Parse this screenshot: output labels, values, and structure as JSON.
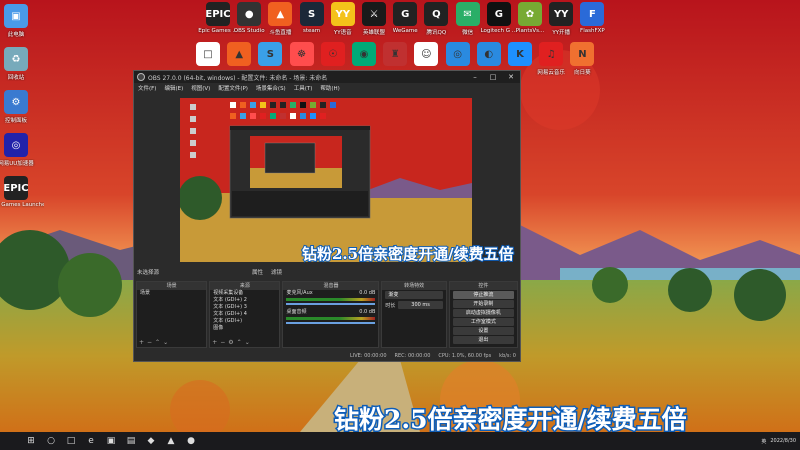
{
  "desktop": {
    "top_icons": [
      {
        "label": "Epic Games ...",
        "glyph": "EPIC",
        "color": "#222222"
      },
      {
        "label": "OBS Studio",
        "glyph": "●",
        "color": "#333333"
      },
      {
        "label": "斗鱼直播",
        "glyph": "▲",
        "color": "#f06020"
      },
      {
        "label": "steam",
        "glyph": "S",
        "color": "#1b2838"
      },
      {
        "label": "YY语音",
        "glyph": "YY",
        "color": "#f4c21a"
      },
      {
        "label": "英雄联盟",
        "glyph": "⚔",
        "color": "#1a1a1a"
      },
      {
        "label": "WeGame",
        "glyph": "G",
        "color": "#222222"
      },
      {
        "label": "腾讯QQ",
        "glyph": "Q",
        "color": "#222222"
      },
      {
        "label": "微信",
        "glyph": "✉",
        "color": "#2aae67"
      },
      {
        "label": "Logitech G ...",
        "glyph": "G",
        "color": "#111111"
      },
      {
        "label": "PlantsVs...",
        "glyph": "✿",
        "color": "#7a3"
      },
      {
        "label": "YY开播",
        "glyph": "YY",
        "color": "#222222"
      },
      {
        "label": "FlashFXP",
        "glyph": "F",
        "color": "#2a6ad8"
      }
    ],
    "second_row_icons": [
      {
        "glyph": "□",
        "color": "#ffffff"
      },
      {
        "glyph": "▲",
        "color": "#f06020"
      },
      {
        "glyph": "S",
        "color": "#3aa0e8"
      },
      {
        "glyph": "☸",
        "color": "#ff4d4d"
      },
      {
        "glyph": "☉",
        "color": "#e02020"
      },
      {
        "glyph": "◉",
        "color": "#0a7"
      },
      {
        "glyph": "♜",
        "color": "#c03030"
      },
      {
        "glyph": "☺",
        "color": "#ffffff"
      },
      {
        "glyph": "◎",
        "color": "#2a8ae0"
      },
      {
        "glyph": "◐",
        "color": "#2a8ae0"
      },
      {
        "glyph": "K",
        "color": "#1e90ff"
      },
      {
        "glyph": "♫",
        "color": "#e02020"
      },
      {
        "glyph": "N",
        "color": "#f07030"
      }
    ],
    "second_row_labels": [
      "网易云音乐",
      "向日葵"
    ],
    "left_icons": [
      {
        "label": "此电脑",
        "glyph": "▣",
        "color": "#4a9ae8"
      },
      {
        "label": "回收站",
        "glyph": "♻",
        "color": "#7ab"
      },
      {
        "label": "控制面板",
        "glyph": "⚙",
        "color": "#3a7ad0"
      },
      {
        "label": "网易UU加速器",
        "glyph": "◎",
        "color": "#22a"
      },
      {
        "label": "Epic Games Launcher",
        "glyph": "EPIC",
        "color": "#222222"
      }
    ]
  },
  "obs": {
    "title": "OBS 27.0.0 (64-bit, windows) - 配置文件: 未命名 - 场景: 未命名",
    "window_buttons": [
      "–",
      "□",
      "✕"
    ],
    "menu": [
      "文件(F)",
      "编辑(E)",
      "视图(V)",
      "配置文件(P)",
      "场景集合(S)",
      "工具(T)",
      "帮助(H)"
    ],
    "scene_info": {
      "label": "未选择源",
      "properties": "属性",
      "filters": "滤镜"
    },
    "docks": {
      "scenes": {
        "header": "场景",
        "items": [
          "场景"
        ]
      },
      "sources": {
        "header": "来源",
        "items": [
          "视频采集设备",
          "文本 (GDI+) 2",
          "文本 (GDI+) 3",
          "文本 (GDI+) 4",
          "文本 (GDI+)",
          "图像"
        ]
      },
      "mixer": {
        "header": "混音器",
        "channels": [
          {
            "name": "麦克风/Aux",
            "level": "0.0 dB"
          },
          {
            "name": "桌面音频",
            "level": "0.0 dB"
          }
        ]
      },
      "transitions": {
        "header": "转场特效",
        "type": "渐变",
        "duration_label": "时长",
        "duration": "300 ms"
      },
      "controls": {
        "header": "控件",
        "buttons": [
          "停止推流",
          "开始录制",
          "启动虚拟摄像机",
          "工作室模式",
          "设置",
          "退出"
        ]
      }
    },
    "status": {
      "live": "LIVE: 00:00:00",
      "rec": "REC: 00:00:00",
      "cpu": "CPU: 1.0%, 60.00 fps",
      "kbps": "kb/s: 0"
    }
  },
  "captions": {
    "small": "钻粉2.5倍亲密度开通/续费五倍",
    "big": "钻粉2.5倍亲密度开通/续费五倍"
  },
  "taskbar": {
    "icons": [
      "start-icon",
      "search-icon",
      "taskview-icon",
      "edge-icon",
      "store-icon",
      "explorer-icon",
      "app-icon",
      "douyu-icon",
      "obs-icon"
    ],
    "glyphs": [
      "⊞",
      "○",
      "□",
      "e",
      "▣",
      "▤",
      "◆",
      "▲",
      "●"
    ],
    "tray_text": "英",
    "date": "2022/8/30"
  }
}
